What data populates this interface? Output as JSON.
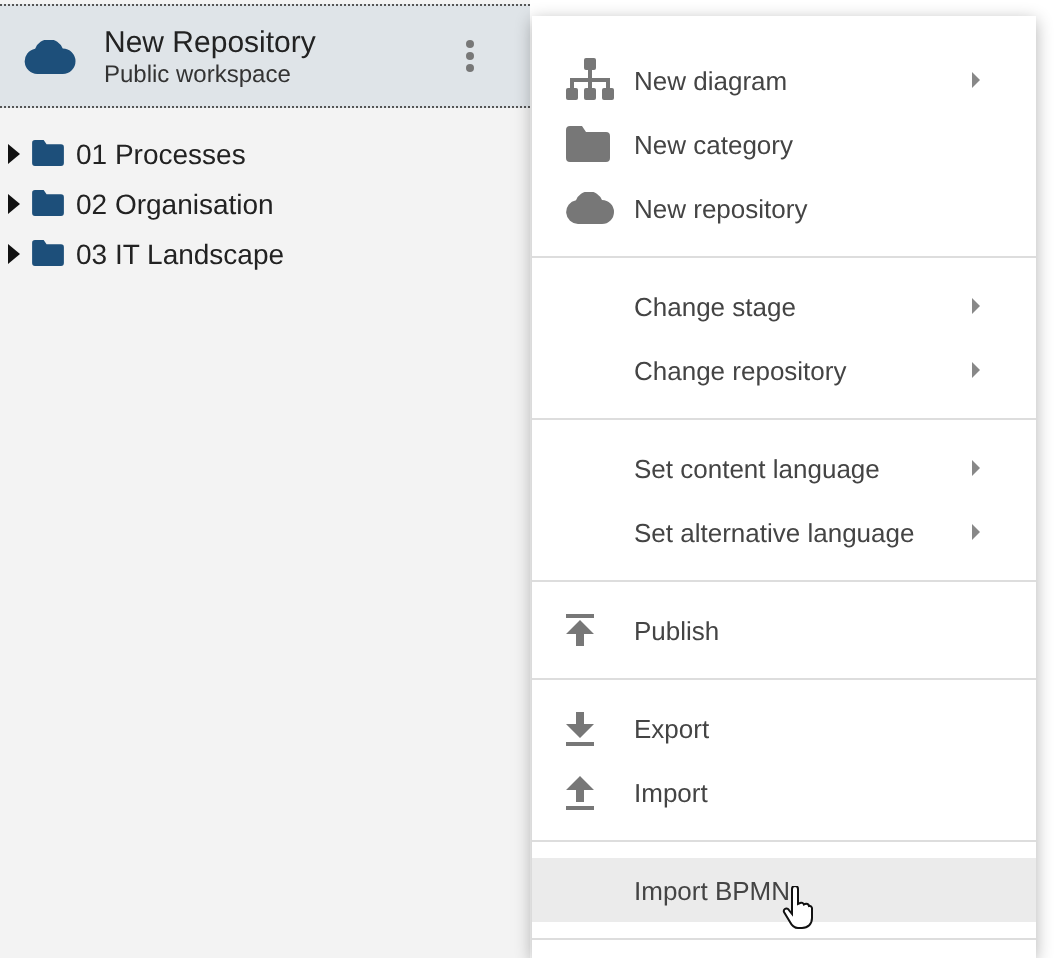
{
  "header": {
    "title": "New Repository",
    "subtitle": "Public workspace"
  },
  "tree": [
    {
      "label": "01 Processes",
      "expanded": false
    },
    {
      "label": "02 Organisation",
      "expanded": false
    },
    {
      "label": "03 IT Landscape",
      "expanded": false
    }
  ],
  "menu": {
    "groups": [
      [
        {
          "label": "New diagram",
          "kind": "sitemap",
          "submenu": true,
          "hovered": false
        },
        {
          "label": "New category",
          "kind": "folder",
          "submenu": false,
          "hovered": false
        },
        {
          "label": "New repository",
          "kind": "cloud",
          "submenu": false,
          "hovered": false
        }
      ],
      [
        {
          "label": "Change stage",
          "submenu": true,
          "hovered": false
        },
        {
          "label": "Change repository",
          "submenu": true,
          "hovered": false
        }
      ],
      [
        {
          "label": "Set content language",
          "submenu": true,
          "hovered": false
        },
        {
          "label": "Set alternative language",
          "submenu": true,
          "hovered": false
        }
      ],
      [
        {
          "label": "Publish",
          "kind": "publish",
          "submenu": false,
          "hovered": false
        }
      ],
      [
        {
          "label": "Export",
          "kind": "download",
          "submenu": false,
          "hovered": false
        },
        {
          "label": "Import",
          "kind": "upload",
          "submenu": false,
          "hovered": false
        }
      ],
      [
        {
          "label": "Import BPMN",
          "submenu": false,
          "hovered": true
        }
      ]
    ]
  }
}
